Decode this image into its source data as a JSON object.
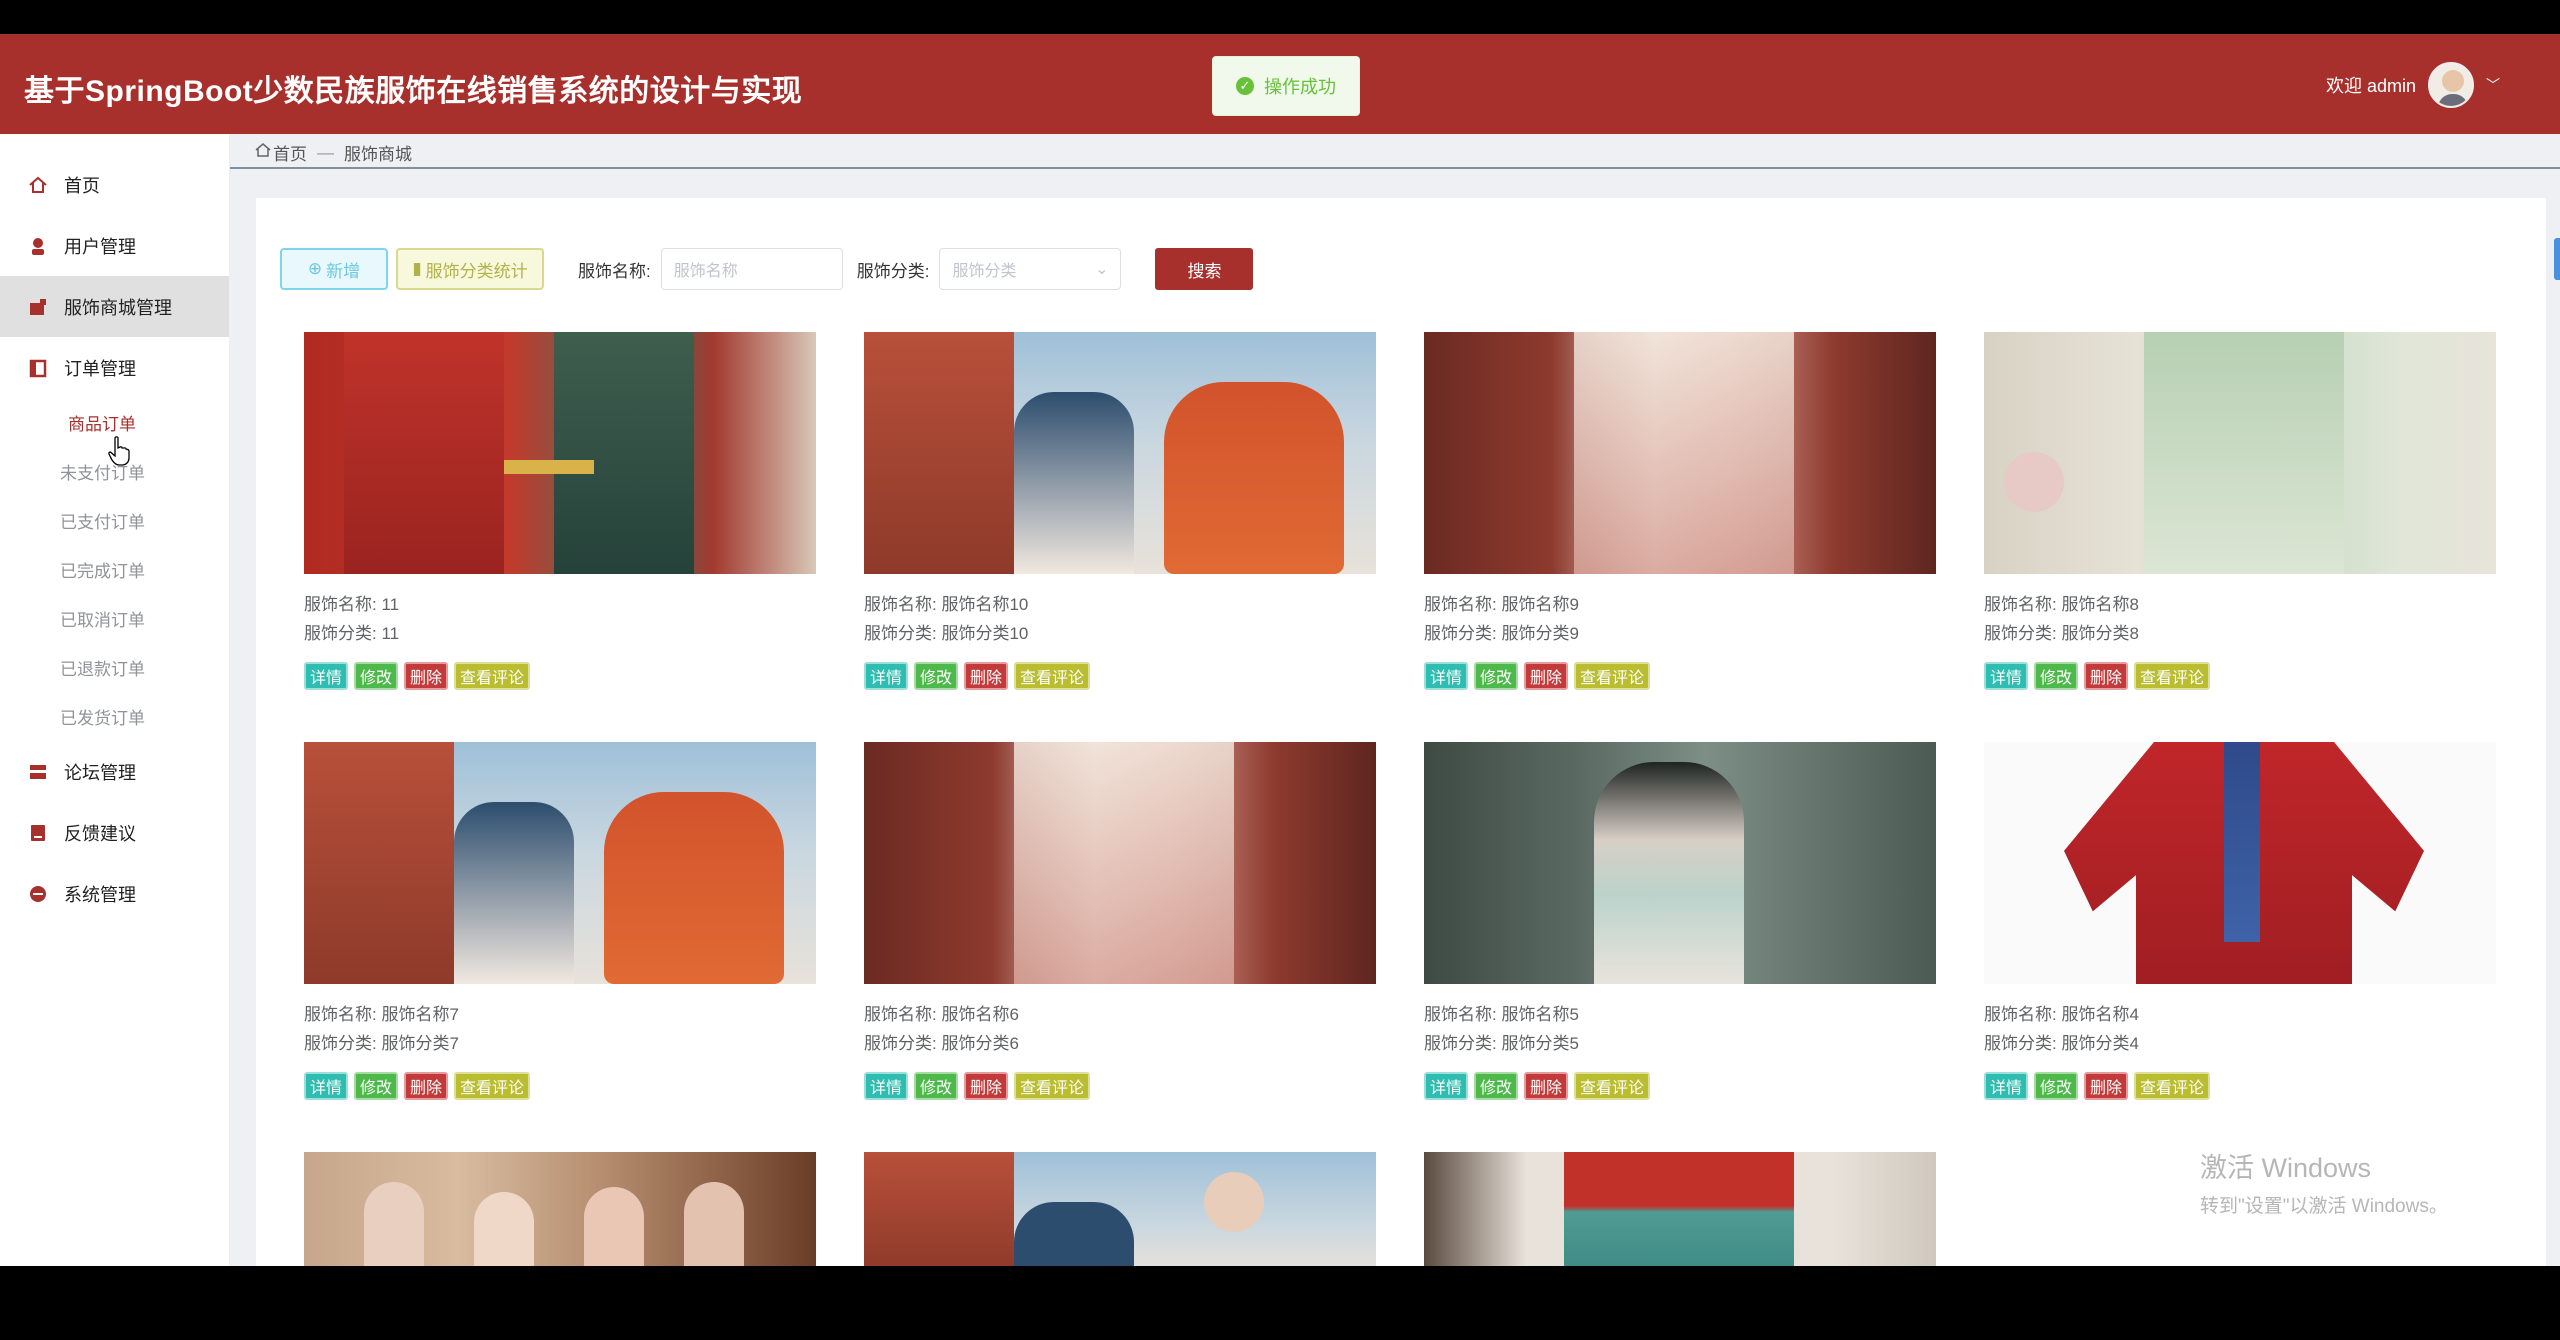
{
  "app": {
    "title": "基于SpringBoot少数民族服饰在线销售系统的设计与实现"
  },
  "toast": {
    "text": "操作成功"
  },
  "user": {
    "welcome": "欢迎 admin"
  },
  "sidebar": {
    "items": [
      {
        "label": "首页",
        "icon": "home-icon"
      },
      {
        "label": "用户管理",
        "icon": "user-icon"
      },
      {
        "label": "服饰商城管理",
        "icon": "shop-icon",
        "active": true
      },
      {
        "label": "订单管理",
        "icon": "order-icon"
      }
    ],
    "subitems": [
      {
        "label": "商品订单",
        "active": true
      },
      {
        "label": "未支付订单"
      },
      {
        "label": "已支付订单"
      },
      {
        "label": "已完成订单"
      },
      {
        "label": "已取消订单"
      },
      {
        "label": "已退款订单"
      },
      {
        "label": "已发货订单"
      }
    ],
    "items_after": [
      {
        "label": "论坛管理",
        "icon": "forum-icon"
      },
      {
        "label": "反馈建议",
        "icon": "feedback-icon"
      },
      {
        "label": "系统管理",
        "icon": "system-icon"
      }
    ]
  },
  "breadcrumb": {
    "home": "首页",
    "current": "服饰商城"
  },
  "toolbar": {
    "add_label": "新增",
    "stat_label": "服饰分类统计",
    "name_label": "服饰名称:",
    "name_placeholder": "服饰名称",
    "category_label": "服饰分类:",
    "category_placeholder": "服饰分类",
    "search_label": "搜索"
  },
  "card_actions": {
    "detail": "详情",
    "edit": "修改",
    "delete": "删除",
    "comments": "查看评论"
  },
  "products": [
    {
      "name_label": "服饰名称:",
      "name": "11",
      "cat_label": "服饰分类:",
      "category": "11"
    },
    {
      "name_label": "服饰名称:",
      "name": "服饰名称10",
      "cat_label": "服饰分类:",
      "category": "服饰分类10"
    },
    {
      "name_label": "服饰名称:",
      "name": "服饰名称9",
      "cat_label": "服饰分类:",
      "category": "服饰分类9"
    },
    {
      "name_label": "服饰名称:",
      "name": "服饰名称8",
      "cat_label": "服饰分类:",
      "category": "服饰分类8"
    },
    {
      "name_label": "服饰名称:",
      "name": "服饰名称7",
      "cat_label": "服饰分类:",
      "category": "服饰分类7"
    },
    {
      "name_label": "服饰名称:",
      "name": "服饰名称6",
      "cat_label": "服饰分类:",
      "category": "服饰分类6"
    },
    {
      "name_label": "服饰名称:",
      "name": "服饰名称5",
      "cat_label": "服饰分类:",
      "category": "服饰分类5"
    },
    {
      "name_label": "服饰名称:",
      "name": "服饰名称4",
      "cat_label": "服饰分类:",
      "category": "服饰分类4"
    }
  ],
  "watermark": {
    "line1": "激活 Windows",
    "line2": "转到\"设置\"以激活 Windows。"
  },
  "colors": {
    "brand": "#a8302c",
    "detail": "#2ebdb0",
    "edit": "#4eb94b",
    "delete": "#c23a3a",
    "comments": "#b9bd2f"
  }
}
